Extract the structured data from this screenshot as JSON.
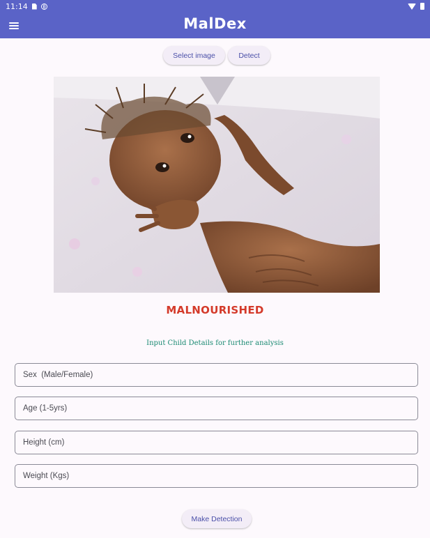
{
  "status_bar": {
    "time": "11:14"
  },
  "app_bar": {
    "title": "MalDex"
  },
  "buttons": {
    "select_image": "Select image",
    "detect": "Detect",
    "make_detection": "Make Detection"
  },
  "result": {
    "label": "MALNOURISHED"
  },
  "form": {
    "prompt": "Input Child Details for further analysis",
    "sex_placeholder": "Sex  (Male/Female)",
    "age_placeholder": "Age (1-5yrs)",
    "height_placeholder": "Height (cm)",
    "weight_placeholder": "Weight (Kgs)"
  },
  "colors": {
    "app_bar": "#5a63c7",
    "result": "#d43a2a",
    "prompt": "#1a8a72"
  }
}
